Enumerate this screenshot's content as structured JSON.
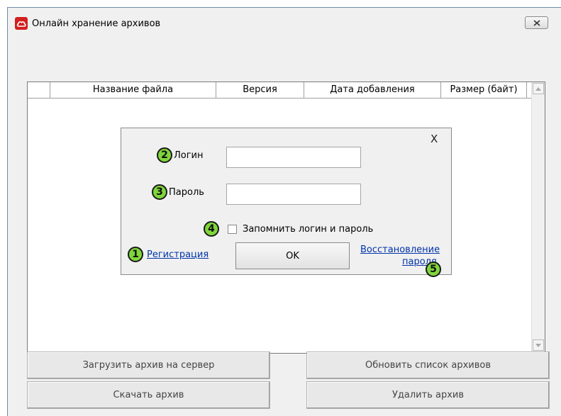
{
  "window": {
    "title": "Онлайн хранение архивов",
    "icon": "cloud-icon",
    "accent_color": "#d21f1f"
  },
  "table": {
    "columns": [
      "",
      "Название файла",
      "Версия",
      "Дата добавления",
      "Размер (байт)"
    ],
    "rows": []
  },
  "login_dialog": {
    "close_glyph": "X",
    "login_label": "Логин",
    "login_value": "",
    "password_label": "Пароль",
    "password_value": "",
    "remember_label": "Запомнить логин и пароль",
    "remember_checked": false,
    "register_link": "Регистрация",
    "ok_label": "OK",
    "recover_line1": "Восстановление",
    "recover_line2": "пароля",
    "badge_color": "#7fd63b",
    "badges": [
      "1",
      "2",
      "3",
      "4",
      "5"
    ]
  },
  "buttons": {
    "upload": "Загрузить архив на сервер",
    "refresh": "Обновить список архивов",
    "download": "Скачать архив",
    "delete": "Удалить архив"
  }
}
